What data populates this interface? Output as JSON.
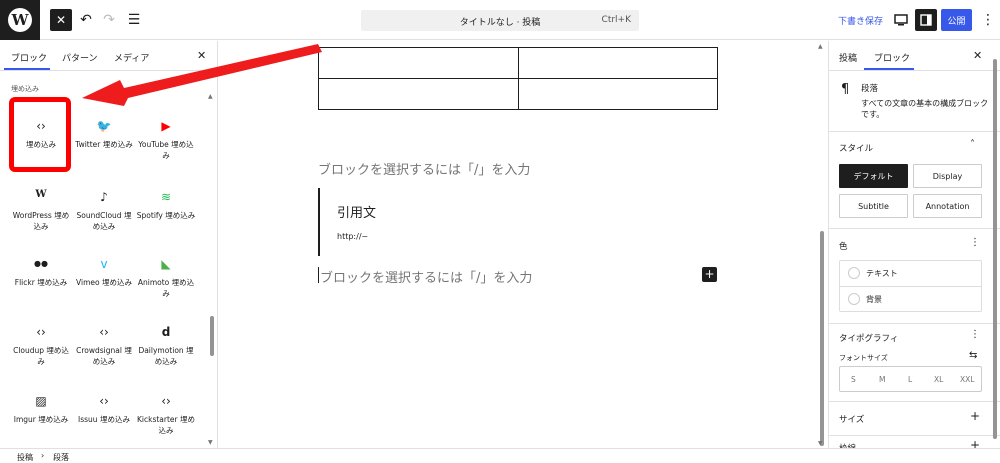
{
  "topbar": {
    "logo": "W",
    "doc_title": "タイトルなし · 投稿",
    "shortcut": "Ctrl+K",
    "save_draft": "下書き保存",
    "publish": "公開",
    "icons": [
      "close-icon",
      "undo-icon",
      "redo-icon",
      "list-view-icon",
      "preview-icon",
      "settings-icon",
      "more-icon"
    ]
  },
  "inserter": {
    "tabs": [
      "ブロック",
      "パターン",
      "メディア"
    ],
    "category": "埋め込み",
    "blocks": [
      {
        "label": "埋め込み",
        "icon": "embed-icon",
        "glyph": "‹›"
      },
      {
        "label": "Twitter 埋め込み",
        "icon": "twitter-icon",
        "glyph": "🐦"
      },
      {
        "label": "YouTube 埋め込み",
        "icon": "youtube-icon",
        "glyph": "▶"
      },
      {
        "label": "WordPress 埋め込み",
        "icon": "wordpress-icon",
        "glyph": "W"
      },
      {
        "label": "SoundCloud 埋め込み",
        "icon": "soundcloud-icon",
        "glyph": "♪"
      },
      {
        "label": "Spotify 埋め込み",
        "icon": "spotify-icon",
        "glyph": "≋"
      },
      {
        "label": "Flickr 埋め込み",
        "icon": "flickr-icon",
        "glyph": "●●"
      },
      {
        "label": "Vimeo 埋め込み",
        "icon": "vimeo-icon",
        "glyph": "v"
      },
      {
        "label": "Animoto 埋め込み",
        "icon": "animoto-icon",
        "glyph": "◣"
      },
      {
        "label": "Cloudup 埋め込み",
        "icon": "cloudup-icon",
        "glyph": "‹›"
      },
      {
        "label": "Crowdsignal 埋め込み",
        "icon": "crowdsignal-icon",
        "glyph": "‹›"
      },
      {
        "label": "Dailymotion 埋め込み",
        "icon": "dailymotion-icon",
        "glyph": "d"
      },
      {
        "label": "Imgur 埋め込み",
        "icon": "imgur-icon",
        "glyph": "▨"
      },
      {
        "label": "Issuu 埋め込み",
        "icon": "issuu-icon",
        "glyph": "‹›"
      },
      {
        "label": "Kickstarter 埋め込み",
        "icon": "kickstarter-icon",
        "glyph": "‹›"
      }
    ]
  },
  "canvas": {
    "placeholder": "ブロックを選択するには「/」を入力",
    "quote_text": "引用文",
    "quote_cite": "http://~"
  },
  "sidebar": {
    "tabs": [
      "投稿",
      "ブロック"
    ],
    "block_title": "段落",
    "block_desc": "すべての文章の基本の構成ブロックです。",
    "style_heading": "スタイル",
    "styles": [
      "デフォルト",
      "Display",
      "Subtitle",
      "Annotation"
    ],
    "color_heading": "色",
    "colors": [
      "テキスト",
      "背景"
    ],
    "typography_heading": "タイポグラフィ",
    "fontsize_label": "フォントサイズ",
    "fontsizes": [
      "S",
      "M",
      "L",
      "XL",
      "XXL"
    ],
    "size_heading": "サイズ",
    "next_heading": "枠線"
  },
  "breadcrumb": [
    "投稿",
    "段落"
  ],
  "colors": {
    "accent": "#3858e9",
    "annotation": "#ff0000"
  }
}
